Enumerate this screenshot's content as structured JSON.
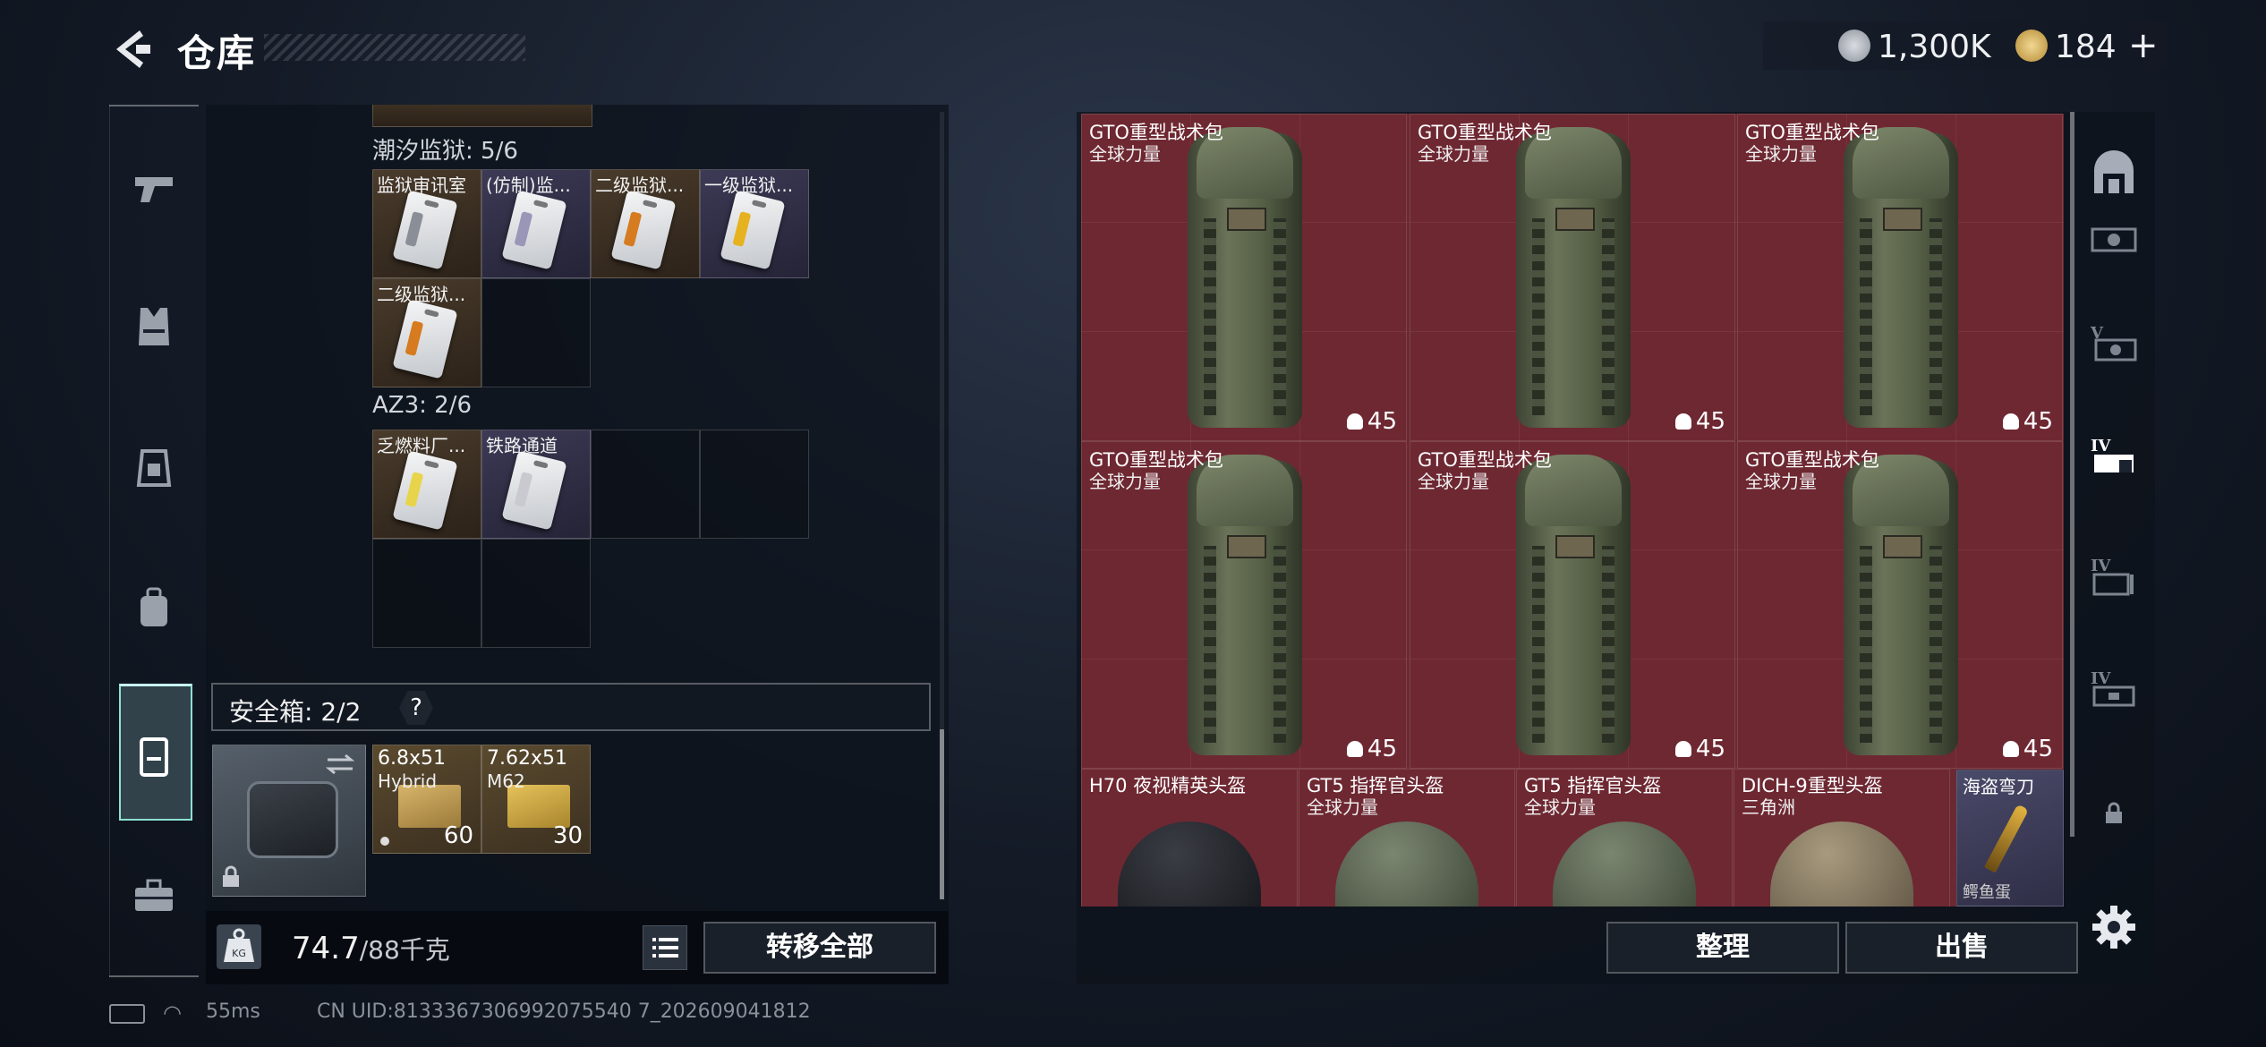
{
  "header": {
    "title": "仓库",
    "coins": "1,300K",
    "tokens": "184",
    "add_symbol": "+"
  },
  "left_panel": {
    "sections": [
      {
        "title": "潮汐监狱: 5/6",
        "items": [
          {
            "label": "监狱审讯室",
            "stripe": "#8a8f97",
            "tint": "brown"
          },
          {
            "label": "(仿制)监...",
            "stripe": "#9a96b8",
            "tint": "purple"
          },
          {
            "label": "二级监狱...",
            "stripe": "#d67b1f",
            "tint": "brown"
          },
          {
            "label": "一级监狱...",
            "stripe": "#e7b21f",
            "tint": "purple"
          },
          {
            "label": "二级监狱...",
            "stripe": "#d67b1f",
            "tint": "brown"
          }
        ]
      },
      {
        "title": "AZ3: 2/6",
        "items": [
          {
            "label": "乏燃料厂...",
            "stripe": "#e8d44a",
            "tint": "brown"
          },
          {
            "label": "铁路通道",
            "stripe": "#c9c9cf",
            "tint": "purple"
          }
        ]
      }
    ],
    "safe_box": {
      "label": "安全箱: 2/2",
      "help": "?",
      "ammo": [
        {
          "name": "6.8x51",
          "sub": "Hybrid",
          "qty": "60"
        },
        {
          "name": "7.62x51",
          "sub": "M62",
          "qty": "30"
        }
      ]
    },
    "weight": {
      "value": "74.7",
      "unit": "/88千克",
      "icon": "KG"
    },
    "transfer_all": "转移全部"
  },
  "right_panel": {
    "backpacks": [
      {
        "name": "GTO重型战术包",
        "origin": "全球力量",
        "capacity": "45"
      },
      {
        "name": "GTO重型战术包",
        "origin": "全球力量",
        "capacity": "45"
      },
      {
        "name": "GTO重型战术包",
        "origin": "全球力量",
        "capacity": "45"
      },
      {
        "name": "GTO重型战术包",
        "origin": "全球力量",
        "capacity": "45"
      },
      {
        "name": "GTO重型战术包",
        "origin": "全球力量",
        "capacity": "45"
      },
      {
        "name": "GTO重型战术包",
        "origin": "全球力量",
        "capacity": "45"
      }
    ],
    "helmets": [
      {
        "name": "H70 夜视精英头盔",
        "origin": "",
        "color": "#1d1f24"
      },
      {
        "name": "GT5 指挥官头盔",
        "origin": "全球力量",
        "color": "#5f6a55"
      },
      {
        "name": "GT5 指挥官头盔",
        "origin": "全球力量",
        "color": "#5f6a55"
      },
      {
        "name": "DICH-9重型头盔",
        "origin": "三角洲",
        "color": "#8f8068"
      }
    ],
    "knife": {
      "name": "海盗弯刀",
      "sub": "鳄鱼蛋"
    },
    "sort": "整理",
    "sell": "出售"
  },
  "status_bar": {
    "ping": "55ms",
    "uid": "CN UID:8133367306992075540 7_202609041812"
  },
  "icons": {
    "nav_left": [
      "pistol-icon",
      "vest-icon",
      "armor-icon",
      "backpack-icon",
      "safe-case-icon",
      "toolbox-icon"
    ],
    "nav_right": [
      "warehouse-home-icon",
      "storage-slot-icon",
      "storage-v-icon",
      "storage-iv-icon",
      "storage-iv-2-icon",
      "storage-iv-3-icon",
      "lock-icon"
    ]
  }
}
